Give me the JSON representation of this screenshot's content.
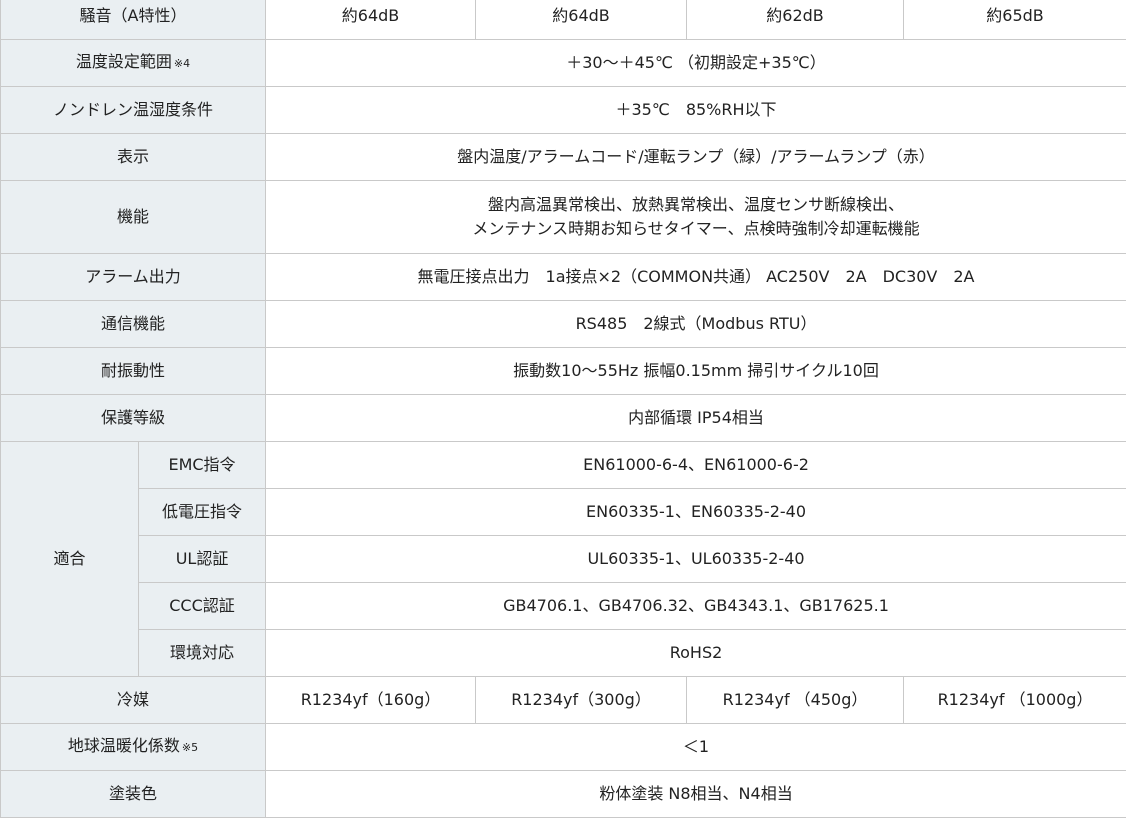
{
  "rows": {
    "noise": {
      "label": "騒音（A特性）",
      "values": [
        "約64dB",
        "約64dB",
        "約62dB",
        "約65dB"
      ]
    },
    "temp_range": {
      "label": "温度設定範囲",
      "note": "※4",
      "value": "＋30～＋45℃ （初期設定+35℃）"
    },
    "non_drain": {
      "label": "ノンドレン温湿度条件",
      "value": "＋35℃　85%RH以下"
    },
    "display": {
      "label": "表示",
      "value": "盤内温度/アラームコード/運転ランプ（緑）/アラームランプ（赤）"
    },
    "function": {
      "label": "機能",
      "value_line1": "盤内高温異常検出、放熱異常検出、温度センサ断線検出、",
      "value_line2": "メンテナンス時期お知らせタイマー、点検時強制冷却運転機能"
    },
    "alarm_output": {
      "label": "アラーム出力",
      "value": "無電圧接点出力　1a接点×2（COMMON共通） AC250V　2A　DC30V　2A"
    },
    "communication": {
      "label": "通信機能",
      "value": "RS485　2線式（Modbus RTU）"
    },
    "vibration": {
      "label": "耐振動性",
      "value": "振動数10～55Hz 振幅0.15mm 掃引サイクル10回"
    },
    "protection": {
      "label": "保護等級",
      "value": "内部循環 IP54相当"
    },
    "compliance": {
      "label": "適合",
      "items": [
        {
          "label": "EMC指令",
          "value": "EN61000-6-4、EN61000-6-2"
        },
        {
          "label": "低電圧指令",
          "value": "EN60335-1、EN60335-2-40"
        },
        {
          "label": "UL認証",
          "value": "UL60335-1、UL60335-2-40"
        },
        {
          "label": "CCC認証",
          "value": "GB4706.1、GB4706.32、GB4343.1、GB17625.1"
        },
        {
          "label": "環境対応",
          "value": "RoHS2"
        }
      ]
    },
    "refrigerant": {
      "label": "冷媒",
      "values": [
        "R1234yf（160g）",
        "R1234yf（300g）",
        "R1234yf （450g）",
        "R1234yf （1000g）"
      ]
    },
    "gwp": {
      "label": "地球温暖化係数",
      "note": "※5",
      "value": "＜1"
    },
    "paint": {
      "label": "塗装色",
      "value": "粉体塗装 N8相当、N4相当"
    }
  }
}
